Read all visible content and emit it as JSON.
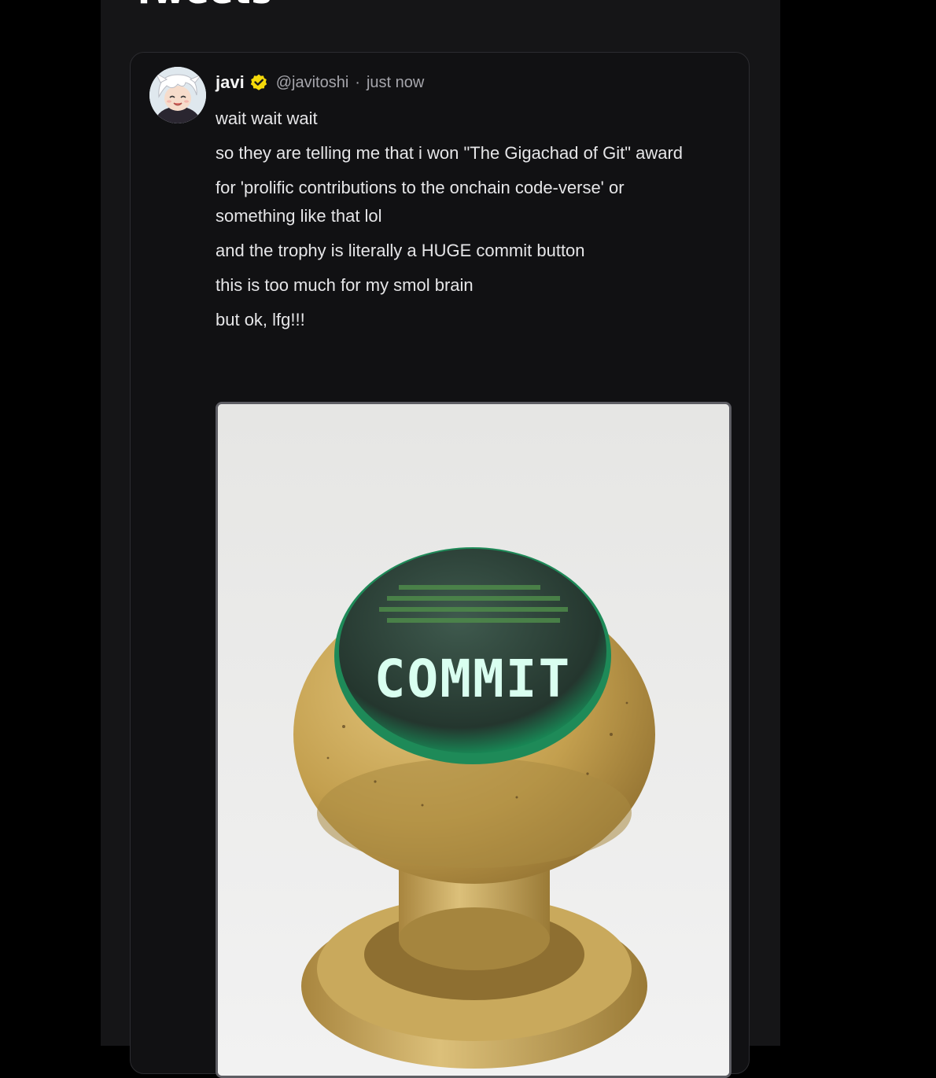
{
  "section": {
    "title": "Tweets"
  },
  "tweet": {
    "author_name": "javi",
    "handle": "@javitoshi",
    "separator": "·",
    "timestamp": "just now",
    "verified_icon": "verified-badge-icon",
    "verified_color": "#f5d90a",
    "paragraphs": [
      "wait wait wait",
      "so they are telling me that i won \"The Gigachad of Git\" award",
      "for 'prolific contributions to the onchain code-verse' or something like that lol",
      "and the trophy is literally a HUGE commit button",
      "this is too much for my smol brain",
      "but ok, lfg!!!"
    ],
    "image": {
      "button_text": "COMMIT"
    }
  },
  "colors": {
    "page_background": "#000000",
    "column_background": "#151517",
    "card_background": "#111113",
    "secondary_text": "#a6a6ac"
  }
}
